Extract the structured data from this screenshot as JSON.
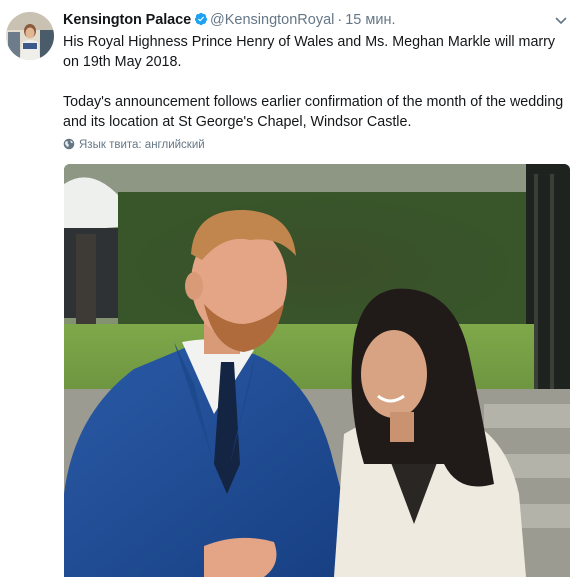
{
  "tweet": {
    "display_name": "Kensington Palace",
    "handle": "@KensingtonRoyal",
    "separator": "·",
    "time": "15 мин.",
    "verified": true,
    "paragraphs": [
      "His Royal Highness Prince Henry of Wales and Ms. Meghan Markle will marry on 19th May 2018.",
      "Today's announcement follows earlier confirmation of the month of the wedding and its location at St George's Chapel, Windsor Castle."
    ],
    "language_note": "Язык твита: английский",
    "icons": {
      "verified": "verified-badge-icon",
      "more": "chevron-down-icon",
      "language": "globe-icon"
    },
    "colors": {
      "verified": "#1da1f2",
      "secondary_text": "#657786",
      "primary_text": "#14171a"
    }
  }
}
